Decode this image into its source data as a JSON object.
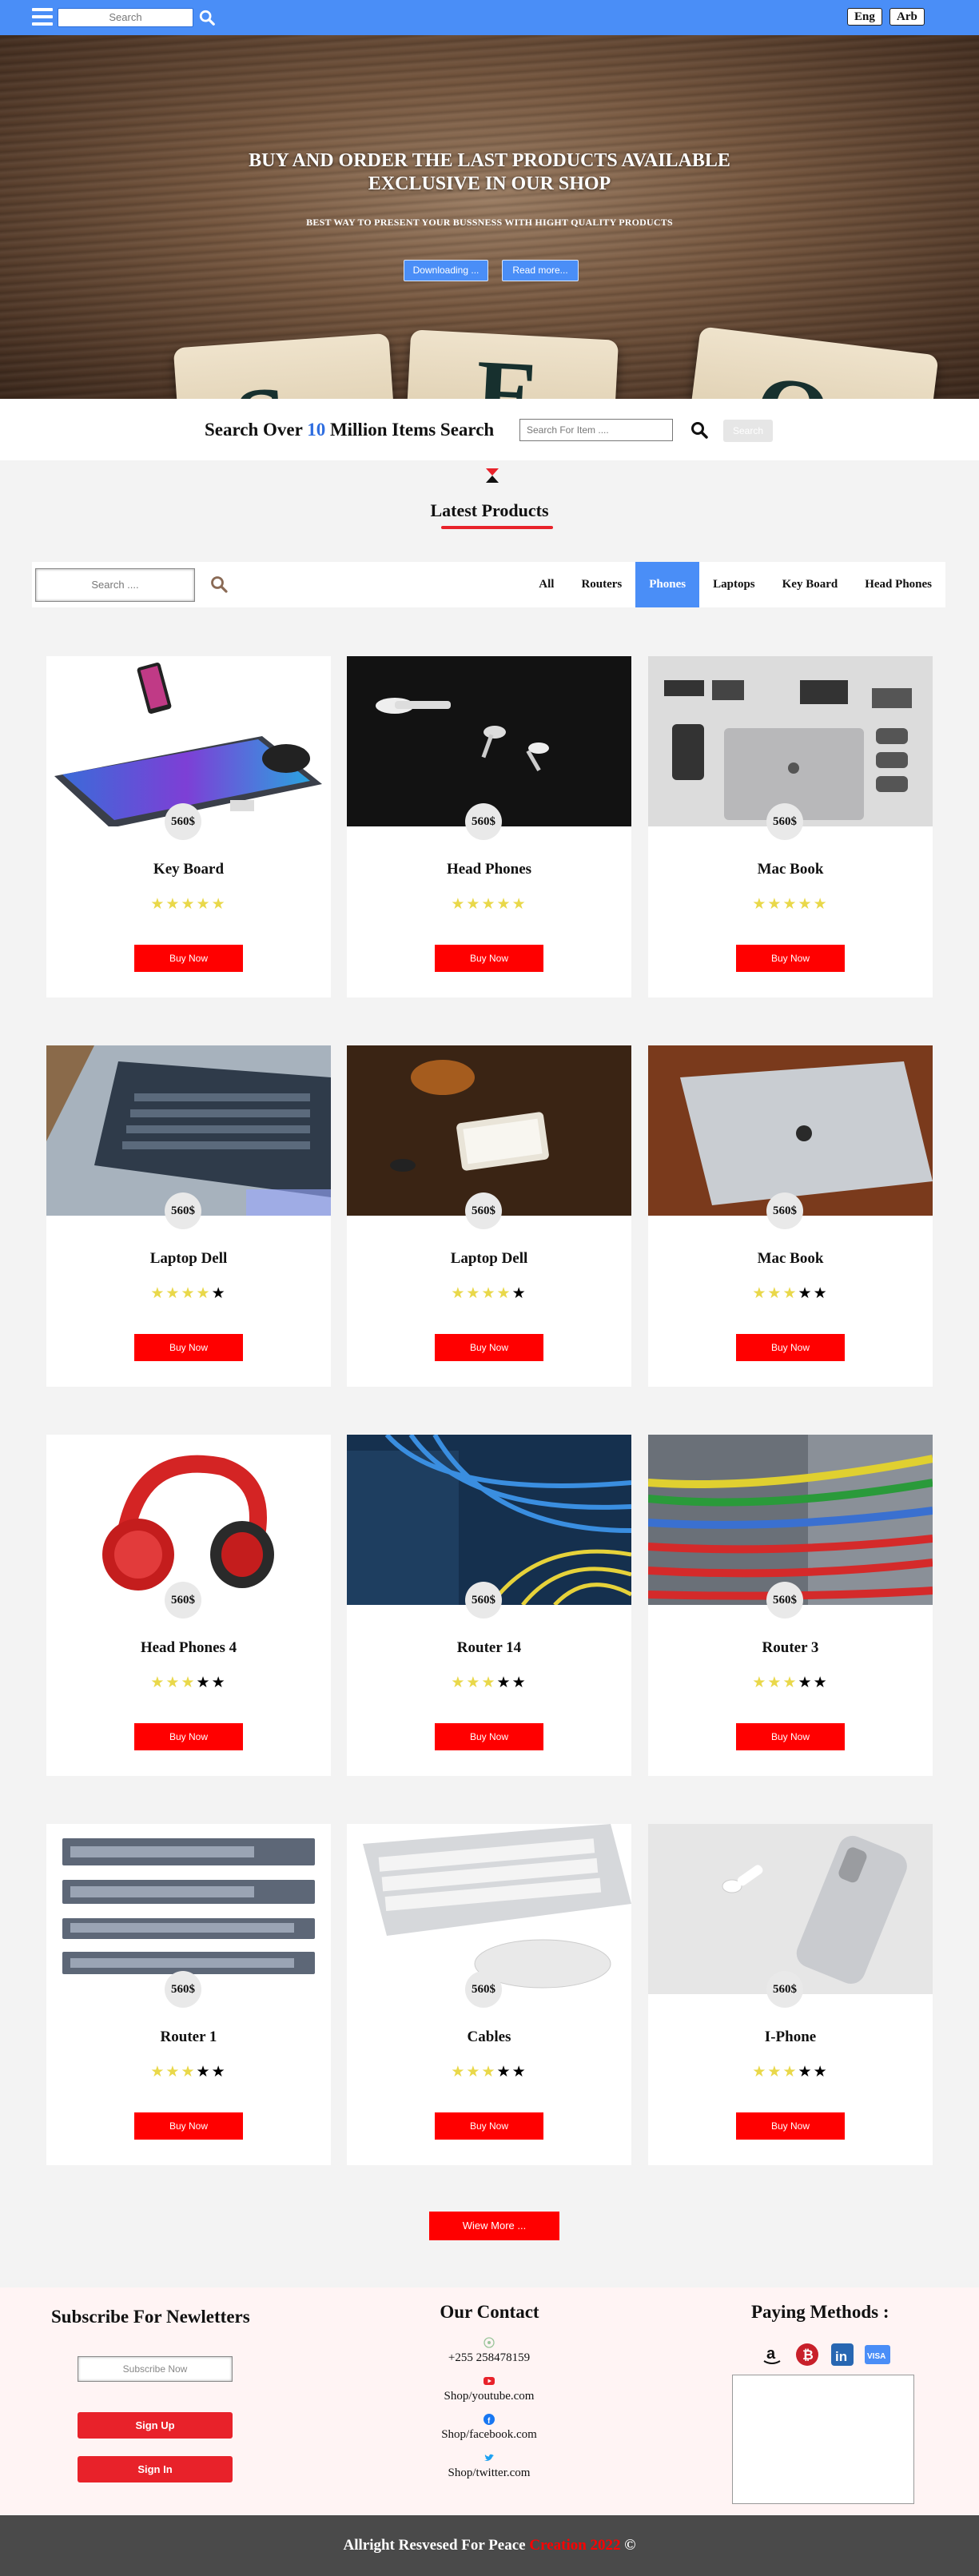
{
  "header": {
    "search_placeholder": "Search",
    "lang_eng": "Eng",
    "lang_arb": "Arb"
  },
  "hero": {
    "title_line1": "BUY AND ORDER THE LAST PRODUCTS AVAILABLE",
    "title_line2": "EXCLUSIVE IN OUR SHOP",
    "subtitle": "BEST WAY TO PRESENT YOUR BUSSNESS WITH HIGHT QUALITY PRODUCTS",
    "btn_download": "Downloading ...",
    "btn_read": "Read more..."
  },
  "search_over": {
    "prefix": "Search Over ",
    "count": "10",
    "suffix": " Million Items Search",
    "placeholder": "Search For Item ....",
    "button": "Search"
  },
  "latest": {
    "title": "Latest Products"
  },
  "filter": {
    "search_placeholder": "Search ....",
    "tabs": [
      "All",
      "Routers",
      "Phones",
      "Laptops",
      "Key Board",
      "Head Phones"
    ],
    "active_tab": "Phones"
  },
  "products": [
    {
      "name": "Key Board",
      "price": "560$",
      "rating": 5
    },
    {
      "name": "Head Phones",
      "price": "560$",
      "rating": 5
    },
    {
      "name": "Mac Book",
      "price": "560$",
      "rating": 5
    },
    {
      "name": "Laptop Dell",
      "price": "560$",
      "rating": 4
    },
    {
      "name": "Laptop Dell",
      "price": "560$",
      "rating": 4
    },
    {
      "name": "Mac Book",
      "price": "560$",
      "rating": 3
    },
    {
      "name": "Head Phones 4",
      "price": "560$",
      "rating": 3
    },
    {
      "name": "Router 14",
      "price": "560$",
      "rating": 3
    },
    {
      "name": "Router 3",
      "price": "560$",
      "rating": 3
    },
    {
      "name": "Router 1",
      "price": "560$",
      "rating": 3
    },
    {
      "name": "Cables",
      "price": "560$",
      "rating": 3
    },
    {
      "name": "I-Phone",
      "price": "560$",
      "rating": 3
    }
  ],
  "buy_label": "Buy Now",
  "view_more": "Wiew More ...",
  "footer": {
    "subscribe_title": "Subscribe For Newletters",
    "subscribe_placeholder": "Subscribe Now",
    "signup": "Sign Up",
    "signin": "Sign In",
    "contact_title": "Our Contact",
    "phone": "+255 258478159",
    "youtube": "Shop/youtube.com",
    "facebook": "Shop/facebook.com",
    "twitter": "Shop/twitter.com",
    "paying_title": "Paying Methods :",
    "copyright_prefix": "Allright Resvesed For Peace ",
    "copyright_red": "Creation 2022",
    "copyright_suffix": " ©"
  },
  "colors": {
    "brand_blue": "#4a8ef7",
    "accent_red": "#ff0000",
    "star": "#e9d84a"
  }
}
